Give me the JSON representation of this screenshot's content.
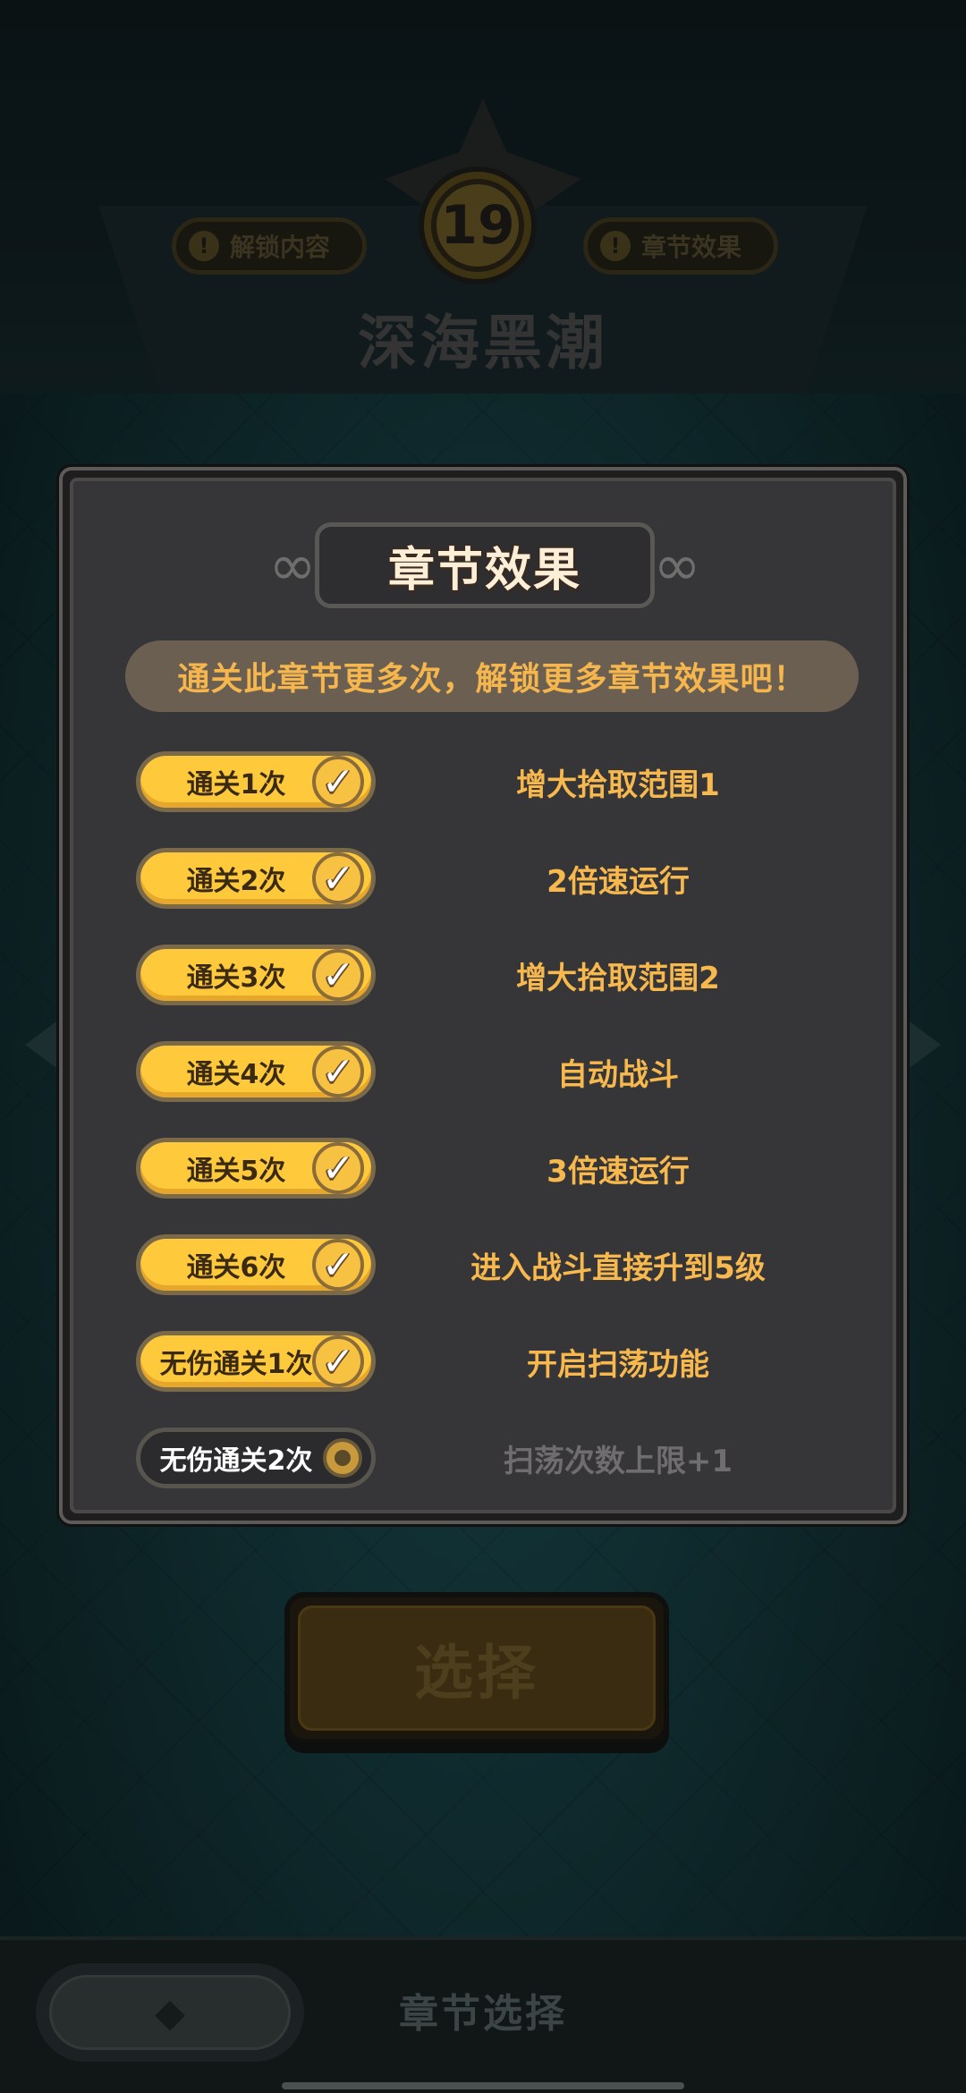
{
  "header": {
    "level_number": "19",
    "unlock_content_label": "解锁内容",
    "chapter_effect_label": "章节效果",
    "chapter_name": "深海黑潮"
  },
  "modal": {
    "title": "章节效果",
    "subtitle": "通关此章节更多次，解锁更多章节效果吧！",
    "effects": [
      {
        "condition": "通关1次",
        "effect": "增大拾取范围1",
        "unlocked": true
      },
      {
        "condition": "通关2次",
        "effect": "2倍速运行",
        "unlocked": true
      },
      {
        "condition": "通关3次",
        "effect": "增大拾取范围2",
        "unlocked": true
      },
      {
        "condition": "通关4次",
        "effect": "自动战斗",
        "unlocked": true
      },
      {
        "condition": "通关5次",
        "effect": "3倍速运行",
        "unlocked": true
      },
      {
        "condition": "通关6次",
        "effect": "进入战斗直接升到5级",
        "unlocked": true
      },
      {
        "condition": "无伤通关1次",
        "effect": "开启扫荡功能",
        "unlocked": true
      },
      {
        "condition": "无伤通关2次",
        "effect": "扫荡次数上限+1",
        "unlocked": false
      }
    ]
  },
  "select_button_label": "选择",
  "bottom_bar": {
    "label": "章节选择",
    "back_icon": "back-arrow-icon"
  },
  "colors": {
    "accent_gold": "#ffc93c",
    "effect_text": "#f7b84d",
    "locked_text": "#6f6d70",
    "panel_bg": "#363538"
  }
}
